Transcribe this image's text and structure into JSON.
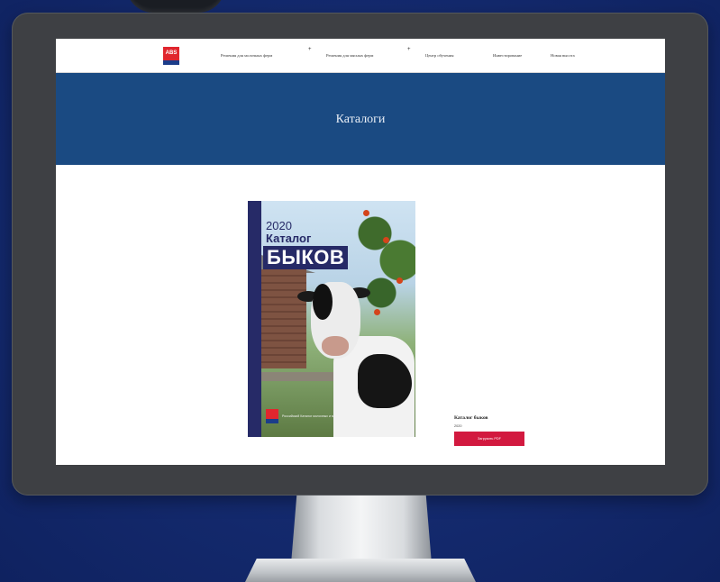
{
  "nav": {
    "logo_text": "ABS",
    "items": [
      {
        "label": "Решения для молочных ферм",
        "has_submenu": true
      },
      {
        "label": "Решения для мясных ферм",
        "has_submenu": true
      },
      {
        "label": "Центр обучения",
        "has_submenu": false
      },
      {
        "label": "Инвестирование",
        "has_submenu": false
      },
      {
        "label": "Новая высота",
        "has_submenu": false
      }
    ],
    "plus_glyph": "+"
  },
  "banner": {
    "title": "Каталоги",
    "color": "#1a4a82"
  },
  "catalog": {
    "year": "2020",
    "subtitle": "Каталог",
    "title": "БЫКОВ",
    "tagline": "Российский Каталог молочных и мясных",
    "accent": "#262a67"
  },
  "card": {
    "title": "Каталог быков",
    "subtitle": "2020",
    "button_label": "Загрузить PDF",
    "button_color": "#d2193f"
  },
  "background_color": "#142a6e",
  "bezel_color": "#3e4044"
}
